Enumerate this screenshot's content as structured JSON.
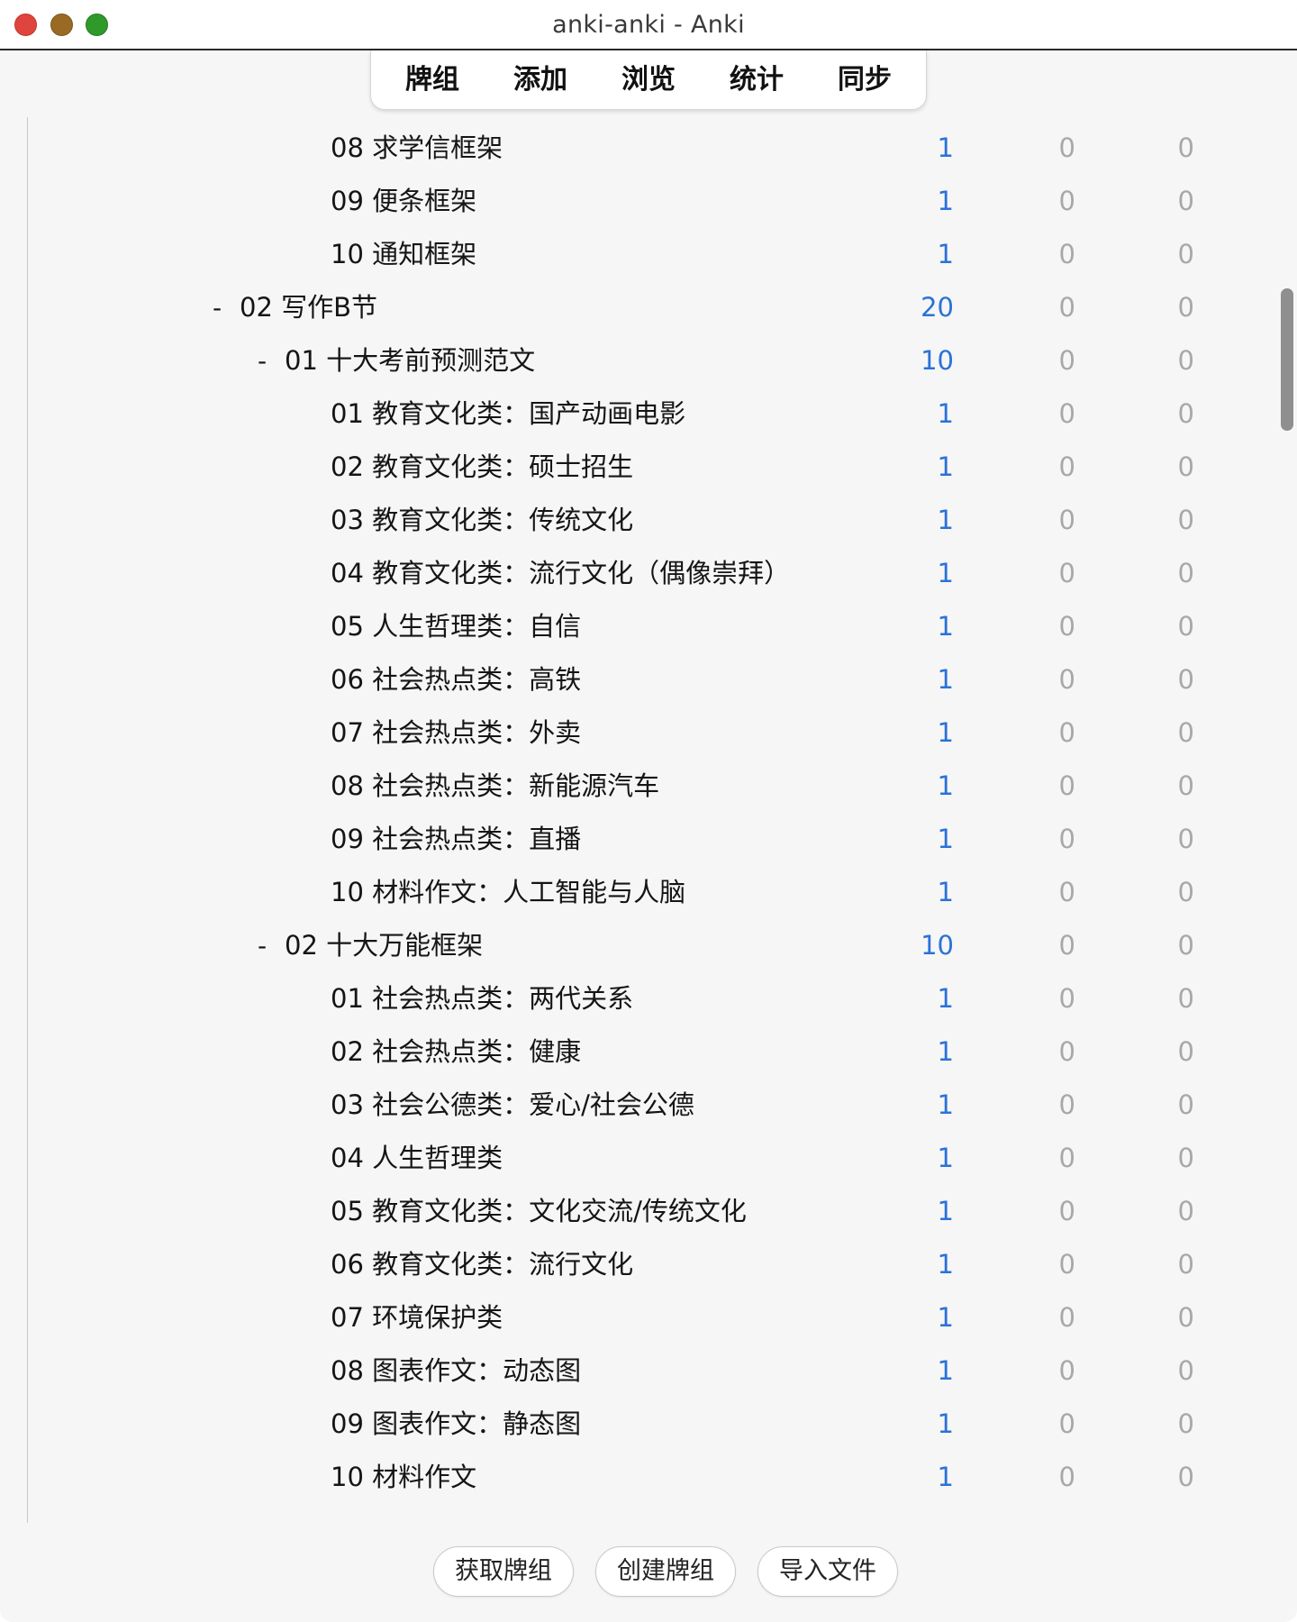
{
  "window": {
    "title": "anki-anki - Anki"
  },
  "toolbar": {
    "decks": "牌组",
    "add": "添加",
    "browse": "浏览",
    "stats": "统计",
    "sync": "同步"
  },
  "decks": [
    {
      "name": "08 求学信框架",
      "level": 3,
      "collapse": "",
      "new": "1",
      "learn": "0",
      "due": "0"
    },
    {
      "name": "09 便条框架",
      "level": 3,
      "collapse": "",
      "new": "1",
      "learn": "0",
      "due": "0"
    },
    {
      "name": "10 通知框架",
      "level": 3,
      "collapse": "",
      "new": "1",
      "learn": "0",
      "due": "0"
    },
    {
      "name": "02 写作B节",
      "level": 1,
      "collapse": "-",
      "new": "20",
      "learn": "0",
      "due": "0"
    },
    {
      "name": "01 十大考前预测范文",
      "level": 2,
      "collapse": "-",
      "new": "10",
      "learn": "0",
      "due": "0"
    },
    {
      "name": "01 教育文化类：国产动画电影",
      "level": 3,
      "collapse": "",
      "new": "1",
      "learn": "0",
      "due": "0"
    },
    {
      "name": "02 教育文化类：硕士招生",
      "level": 3,
      "collapse": "",
      "new": "1",
      "learn": "0",
      "due": "0"
    },
    {
      "name": "03 教育文化类：传统文化",
      "level": 3,
      "collapse": "",
      "new": "1",
      "learn": "0",
      "due": "0"
    },
    {
      "name": "04 教育文化类：流行文化（偶像崇拜）",
      "level": 3,
      "collapse": "",
      "new": "1",
      "learn": "0",
      "due": "0"
    },
    {
      "name": "05 人生哲理类：自信",
      "level": 3,
      "collapse": "",
      "new": "1",
      "learn": "0",
      "due": "0"
    },
    {
      "name": "06 社会热点类：高铁",
      "level": 3,
      "collapse": "",
      "new": "1",
      "learn": "0",
      "due": "0"
    },
    {
      "name": "07 社会热点类：外卖",
      "level": 3,
      "collapse": "",
      "new": "1",
      "learn": "0",
      "due": "0"
    },
    {
      "name": "08 社会热点类：新能源汽车",
      "level": 3,
      "collapse": "",
      "new": "1",
      "learn": "0",
      "due": "0"
    },
    {
      "name": "09 社会热点类：直播",
      "level": 3,
      "collapse": "",
      "new": "1",
      "learn": "0",
      "due": "0"
    },
    {
      "name": "10 材料作文：人工智能与人脑",
      "level": 3,
      "collapse": "",
      "new": "1",
      "learn": "0",
      "due": "0"
    },
    {
      "name": "02 十大万能框架",
      "level": 2,
      "collapse": "-",
      "new": "10",
      "learn": "0",
      "due": "0"
    },
    {
      "name": "01 社会热点类：两代关系",
      "level": 3,
      "collapse": "",
      "new": "1",
      "learn": "0",
      "due": "0"
    },
    {
      "name": "02 社会热点类：健康",
      "level": 3,
      "collapse": "",
      "new": "1",
      "learn": "0",
      "due": "0"
    },
    {
      "name": "03 社会公德类：爱心/社会公德",
      "level": 3,
      "collapse": "",
      "new": "1",
      "learn": "0",
      "due": "0"
    },
    {
      "name": "04 人生哲理类",
      "level": 3,
      "collapse": "",
      "new": "1",
      "learn": "0",
      "due": "0"
    },
    {
      "name": "05 教育文化类：文化交流/传统文化",
      "level": 3,
      "collapse": "",
      "new": "1",
      "learn": "0",
      "due": "0"
    },
    {
      "name": "06 教育文化类：流行文化",
      "level": 3,
      "collapse": "",
      "new": "1",
      "learn": "0",
      "due": "0"
    },
    {
      "name": "07 环境保护类",
      "level": 3,
      "collapse": "",
      "new": "1",
      "learn": "0",
      "due": "0"
    },
    {
      "name": "08 图表作文：动态图",
      "level": 3,
      "collapse": "",
      "new": "1",
      "learn": "0",
      "due": "0"
    },
    {
      "name": "09 图表作文：静态图",
      "level": 3,
      "collapse": "",
      "new": "1",
      "learn": "0",
      "due": "0"
    },
    {
      "name": "10 材料作文",
      "level": 3,
      "collapse": "",
      "new": "1",
      "learn": "0",
      "due": "0"
    }
  ],
  "footer": {
    "get_shared": "获取牌组",
    "create_deck": "创建牌组",
    "import_file": "导入文件"
  },
  "colors": {
    "new_count": "#2a72d8",
    "zero_count": "#a8a8a8"
  }
}
